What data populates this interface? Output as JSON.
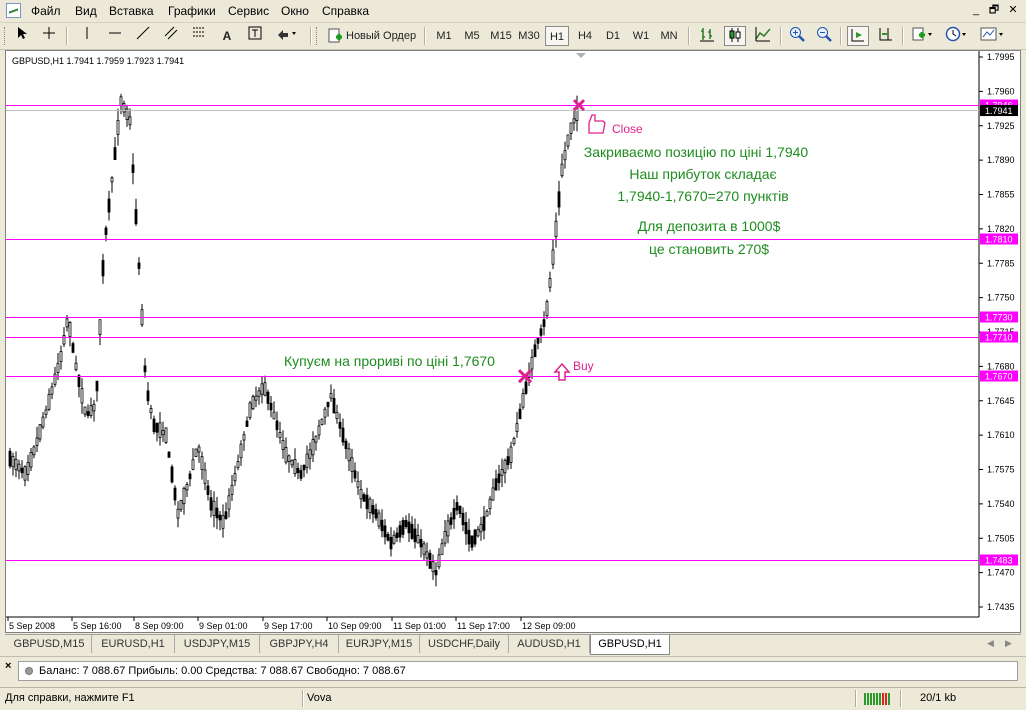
{
  "menu": [
    "Файл",
    "Вид",
    "Вставка",
    "Графики",
    "Сервис",
    "Окно",
    "Справка"
  ],
  "window_buttons": [
    "_",
    "🗗",
    "✕"
  ],
  "toolbar": {
    "new_order_label": "Новый Ордер",
    "timeframes": [
      "M1",
      "M5",
      "M15",
      "M30",
      "H1",
      "H4",
      "D1",
      "W1",
      "MN"
    ],
    "selected_timeframe": "H1"
  },
  "chart": {
    "header": "GBPUSD,H1  1.7941 1.7959 1.7923 1.7941",
    "price_labels": [
      "1.7995",
      "1.7960",
      "1.7925",
      "1.7890",
      "1.7855",
      "1.7820",
      "1.7785",
      "1.7750",
      "1.7715",
      "1.7680",
      "1.7645",
      "1.7610",
      "1.7575",
      "1.7540",
      "1.7505",
      "1.7470",
      "1.7435"
    ],
    "time_labels": [
      "5 Sep 2008",
      "5 Sep 16:00",
      "8 Sep 09:00",
      "9 Sep 01:00",
      "9 Sep 17:00",
      "10 Sep 09:00",
      "11 Sep 01:00",
      "11 Sep 17:00",
      "12 Sep 09:00"
    ],
    "level_labels": [
      "1.7946",
      "1.7810",
      "1.7730",
      "1.7710",
      "1.7670",
      "1.7483"
    ],
    "current_price_label": "1.7941",
    "annotations": {
      "close_label": "Close",
      "buy_label": "Buy",
      "buy_text": "Купуєм на прориві по ціні 1,7670",
      "close_text_1": "Закриваємо позицію по ціні 1,7940",
      "close_text_2": "Наш прибуток складає",
      "close_text_3": "1,7940-1,7670=270 пунктів",
      "deposit_text_1": "Для депозита в 1000$",
      "deposit_text_2": "це становить 270$"
    },
    "colors": {
      "level": "#ff00ff",
      "annotation_green": "#1e8c1e",
      "annotation_pink": "#e0208c"
    }
  },
  "tabs": [
    "GBPUSD,M15",
    "EURUSD,H1",
    "USDJPY,M15",
    "GBPJPY,H4",
    "EURJPY,M15",
    "USDCHF,Daily",
    "AUDUSD,H1",
    "GBPUSD,H1"
  ],
  "active_tab": "GBPUSD,H1",
  "terminal": {
    "balance": "Баланс: 7 088.67  Прибыль: 0.00  Средства: 7 088.67  Свободно: 7 088.67"
  },
  "status": {
    "help": "Для справки, нажмите F1",
    "profile": "Vova",
    "traffic": "20/1 kb"
  }
}
